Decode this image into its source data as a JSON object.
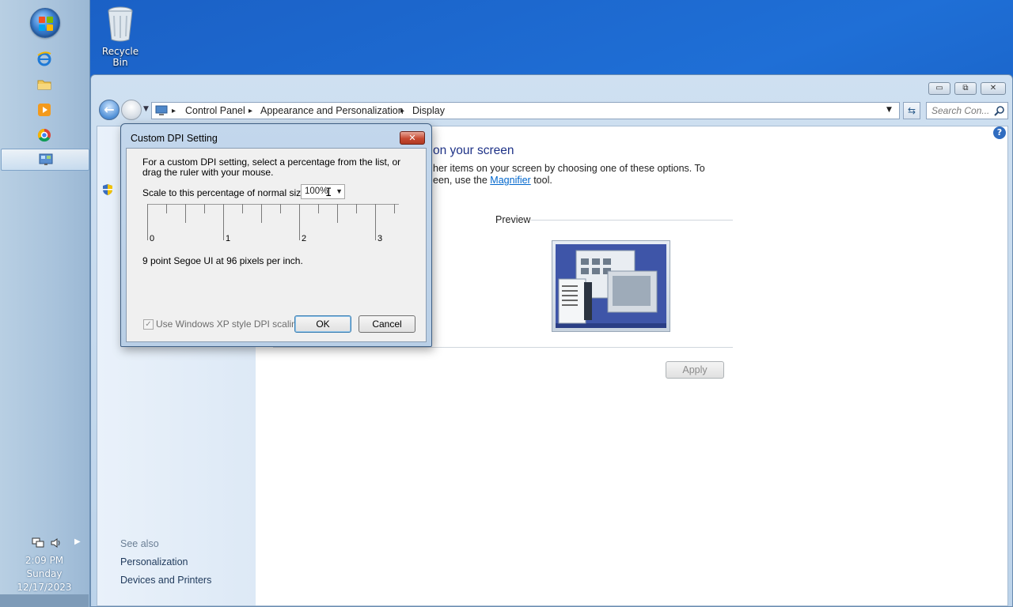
{
  "desktop": {
    "recycle_bin_label": "Recycle Bin"
  },
  "taskbar": {
    "pinned": [
      "internet-explorer-icon",
      "folder-icon",
      "media-player-icon",
      "chrome-icon",
      "control-panel-icon"
    ],
    "clock": {
      "time": "2:09 PM",
      "day": "Sunday",
      "date": "12/17/2023"
    }
  },
  "window": {
    "breadcrumb": [
      "Control Panel",
      "Appearance and Personalization",
      "Display"
    ],
    "search_placeholder": "Search Con...",
    "heading_partial": "on your screen",
    "body_line1": "her items on your screen by choosing one of these options. To",
    "body_line2_prefix": "een, use the",
    "magnifier_link": "Magnifier",
    "body_line2_suffix": "tool.",
    "preview_label": "Preview",
    "apply_label": "Apply",
    "see_also": {
      "title": "See also",
      "links": [
        "Personalization",
        "Devices and Printers"
      ]
    }
  },
  "dialog": {
    "title": "Custom DPI Setting",
    "instructions_line1": "For a custom DPI setting, select a percentage from the list, or",
    "instructions_line2": "drag the ruler with your mouse.",
    "scale_label": "Scale to this percentage of normal size:",
    "scale_value": "100%",
    "ruler_labels": [
      "0",
      "1",
      "2",
      "3"
    ],
    "font_info": "9 point Segoe UI at 96 pixels per inch.",
    "xp_scaling_label": "Use Windows XP style DPI scaling",
    "xp_scaling_checked": true,
    "ok_label": "OK",
    "cancel_label": "Cancel"
  },
  "colors": {
    "desktop_blue": "#1a5fc4",
    "heading_blue": "#1e3287",
    "link_blue": "#0066cc",
    "close_red": "#c74a33"
  }
}
